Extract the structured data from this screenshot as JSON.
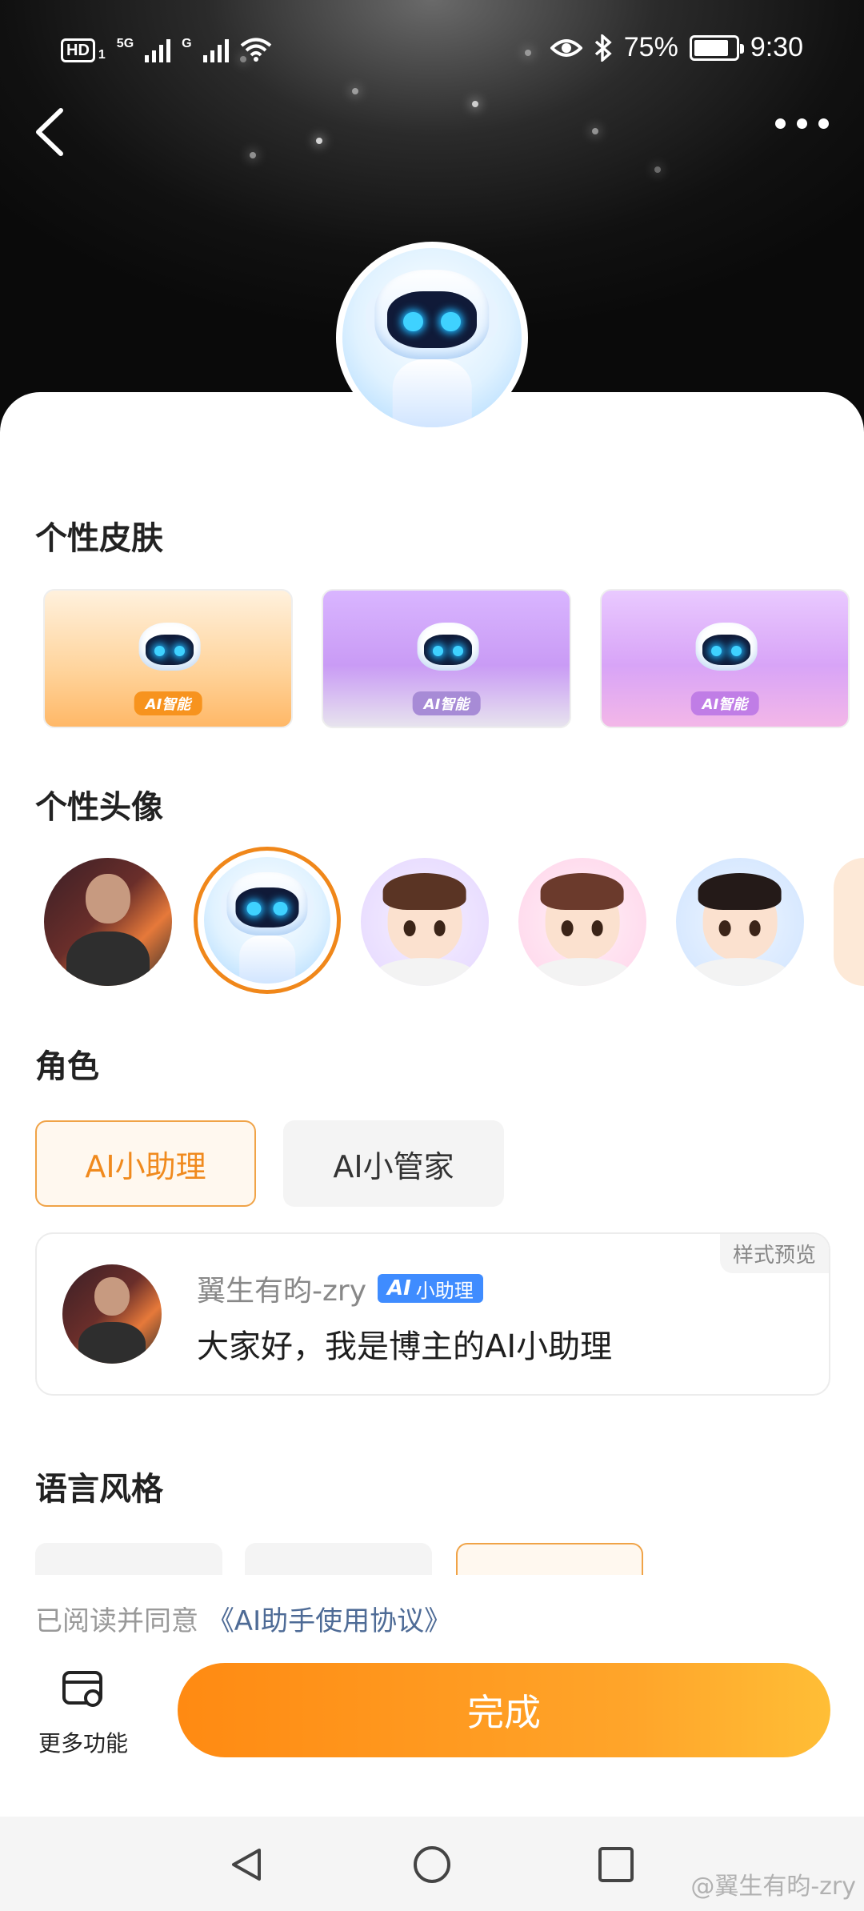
{
  "status_bar": {
    "hd": "HD",
    "sim": "1",
    "net1": "5G",
    "net2": "G",
    "battery": "75%",
    "time": "9:30"
  },
  "colors": {
    "accent": "#f08a1e",
    "done_gradient": [
      "#ff8a12",
      "#ffbe36"
    ],
    "link": "#4e6b96",
    "ai_badge": "#3f8cff"
  },
  "sections": {
    "skin": "个性皮肤",
    "avatar": "个性头像",
    "role": "角色",
    "language": "语言风格"
  },
  "skins": [
    {
      "badge": "AI智能",
      "theme": "orange"
    },
    {
      "badge": "AI智能",
      "theme": "silver-purple"
    },
    {
      "badge": "AI智能",
      "theme": "pink-purple"
    }
  ],
  "avatars": [
    {
      "name": "photo-person",
      "selected": false
    },
    {
      "name": "robot",
      "selected": true
    },
    {
      "name": "cartoon-boy",
      "selected": false
    },
    {
      "name": "cartoon-girl",
      "selected": false
    },
    {
      "name": "cartoon-man",
      "selected": false
    },
    {
      "name": "cartoon-partial",
      "selected": false
    }
  ],
  "roles": [
    {
      "label": "AI小助理",
      "active": true
    },
    {
      "label": "AI小管家",
      "active": false
    }
  ],
  "preview": {
    "tag": "样式预览",
    "name": "翼生有昀-zry",
    "badge_ai": "AI",
    "badge_text": "小助理",
    "message": "大家好，我是博主的AI小助理"
  },
  "agreement": {
    "prefix": "已阅读并同意",
    "link": "《AI助手使用协议》"
  },
  "footer": {
    "more_features": "更多功能",
    "done": "完成"
  },
  "watermark": "@翼生有昀-zry"
}
